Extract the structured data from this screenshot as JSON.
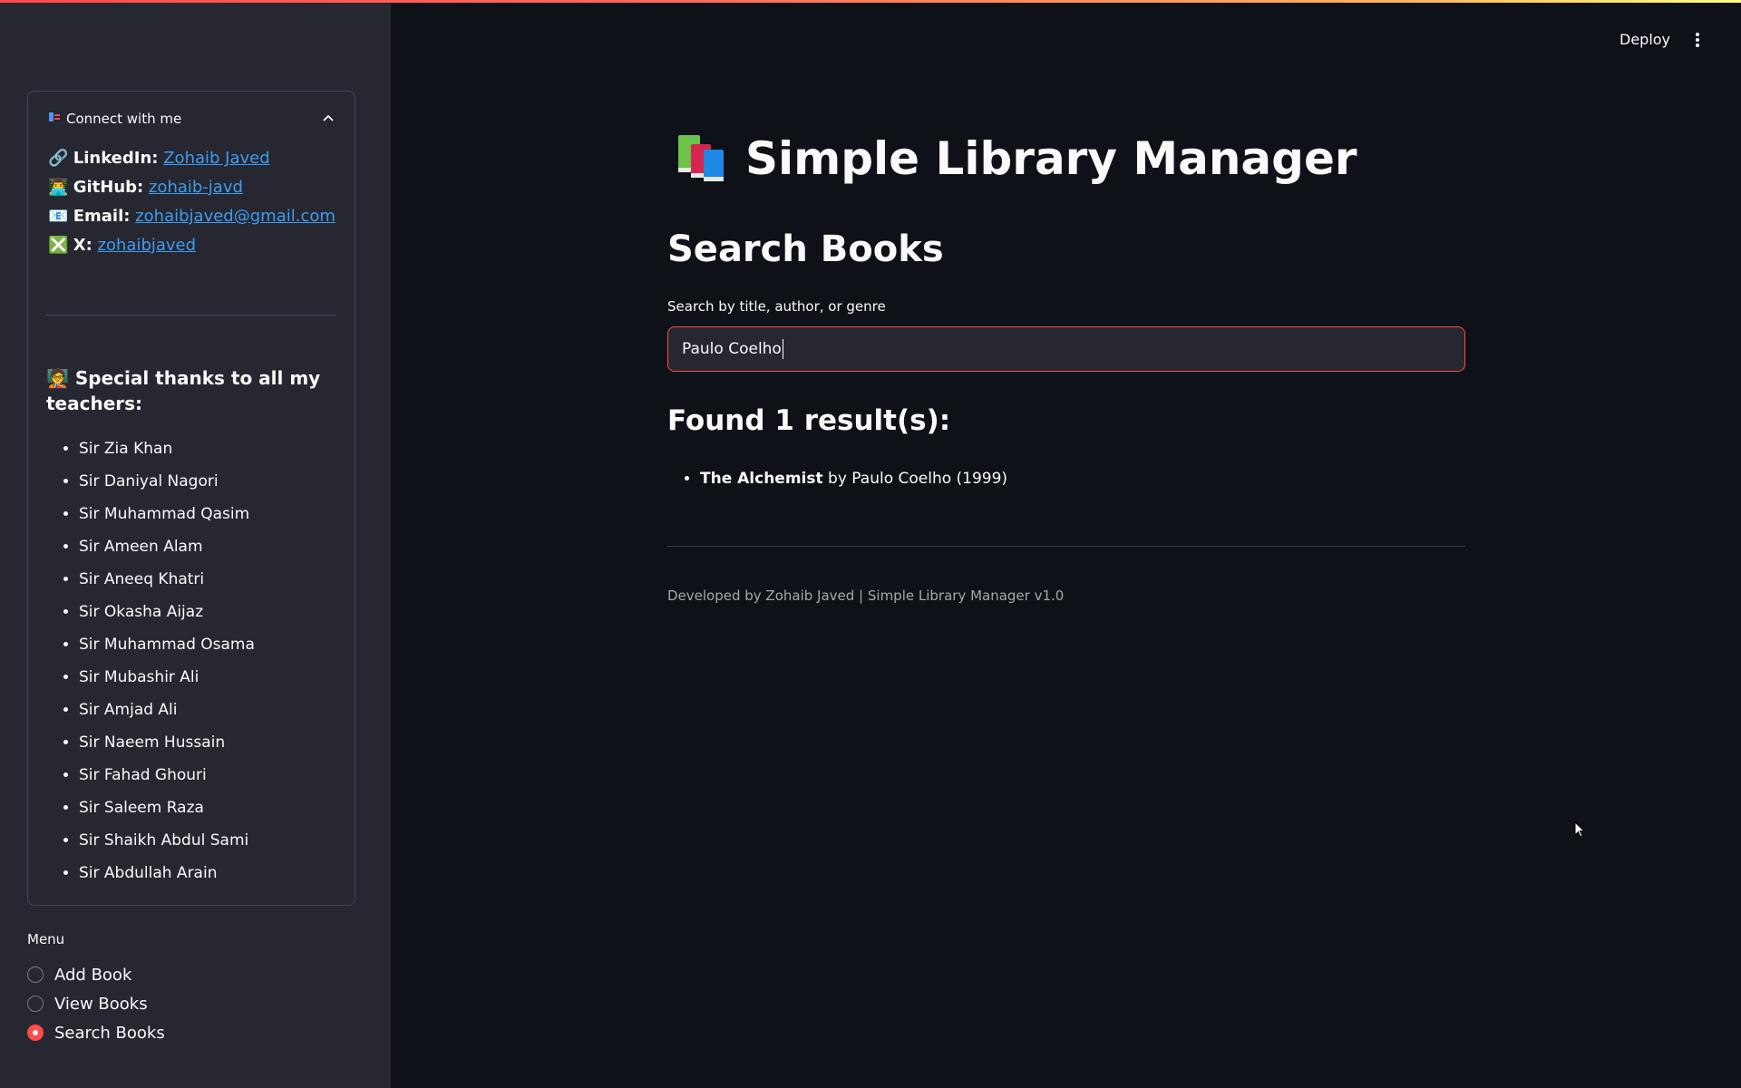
{
  "header": {
    "deploy_label": "Deploy",
    "menu_icon": "kebab-vertical-icon"
  },
  "sidebar": {
    "expander": {
      "title": "Connect with me",
      "icon": "connect-icon",
      "contacts": [
        {
          "icon": "link-icon",
          "glyph": "🔗",
          "label": "LinkedIn:",
          "link_text": "Zohaib Javed"
        },
        {
          "icon": "developer-icon",
          "glyph": "👨‍💻",
          "label": "GitHub:",
          "link_text": "zohaib-javd"
        },
        {
          "icon": "email-icon",
          "glyph": "📧",
          "label": "Email:",
          "link_text": "zohaibjaved@gmail.com"
        },
        {
          "icon": "x-icon",
          "glyph": "❎",
          "label": "X:",
          "link_text": "zohaibjaved"
        }
      ],
      "thanks_icon": "🧑‍🏫",
      "thanks_heading": "Special thanks to all my teachers:",
      "teachers": [
        "Sir Zia Khan",
        "Sir Daniyal Nagori",
        "Sir Muhammad Qasim",
        "Sir Ameen Alam",
        "Sir Aneeq Khatri",
        "Sir Okasha Aijaz",
        "Sir Muhammad Osama",
        "Sir Mubashir Ali",
        "Sir Amjad Ali",
        "Sir Naeem Hussain",
        "Sir Fahad Ghouri",
        "Sir Saleem Raza",
        "Sir Shaikh Abdul Sami",
        "Sir Abdullah Arain"
      ]
    },
    "menu": {
      "label": "Menu",
      "options": [
        "Add Book",
        "View Books",
        "Search Books"
      ],
      "selected": "Search Books"
    }
  },
  "main": {
    "title_icon": "books-icon",
    "title": "Simple Library Manager",
    "section_title": "Search Books",
    "search": {
      "label": "Search by title, author, or genre",
      "value": "Paulo Coelho"
    },
    "results_heading": "Found 1 result(s):",
    "results": [
      {
        "title": "The Alchemist",
        "rest": " by Paulo Coelho (1999)"
      }
    ],
    "footer": "Developed by Zohaib Javed | Simple Library Manager v1.0"
  },
  "colors": {
    "background": "#0e1117",
    "sidebar": "#262730",
    "accent": "#ff4b4b",
    "link": "#3d9df3",
    "footer_text": "#a6a8ae"
  }
}
